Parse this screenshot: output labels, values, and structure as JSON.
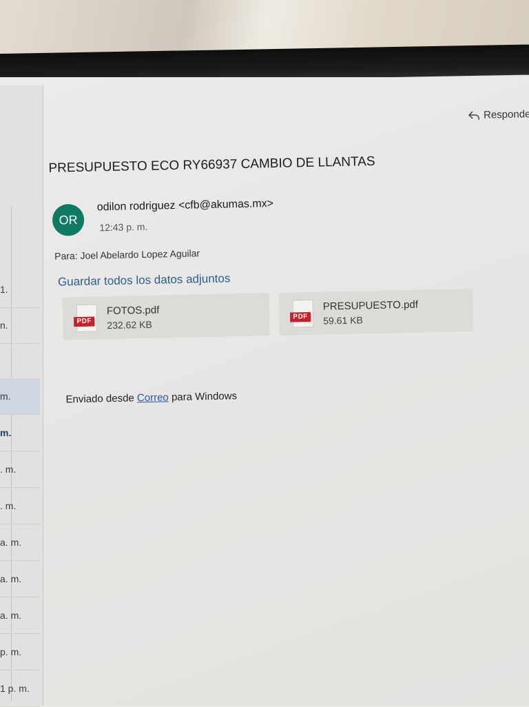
{
  "reply_label": "Responde",
  "email": {
    "subject": "PRESUPUESTO ECO RY66937 CAMBIO DE LLANTAS",
    "avatar_initials": "OR",
    "sender": "odilon rodriguez <cfb@akumas.mx>",
    "time": "12:43 p. m.",
    "to_label": "Para:",
    "to_value": "Joel Abelardo Lopez Aguilar",
    "save_all_label": "Guardar todos los datos adjuntos",
    "attachments": [
      {
        "icon": "pdf-icon",
        "badge": "PDF",
        "name": "FOTOS.pdf",
        "size": "232.62 KB"
      },
      {
        "icon": "pdf-icon",
        "badge": "PDF",
        "name": "PRESUPUESTO.pdf",
        "size": "59.61 KB"
      }
    ],
    "body_prefix": "Enviado desde",
    "body_link": "Correo",
    "body_suffix": "para Windows"
  },
  "message_list": {
    "times": [
      "1.",
      "n.",
      "m.",
      "m.",
      ". m.",
      ". m.",
      "a. m.",
      "a. m.",
      "a. m.",
      "p. m.",
      "1 p. m."
    ]
  },
  "colors": {
    "avatar": "#0f7a64",
    "link": "#2b5f8e",
    "pdf_badge": "#c81f2a"
  }
}
